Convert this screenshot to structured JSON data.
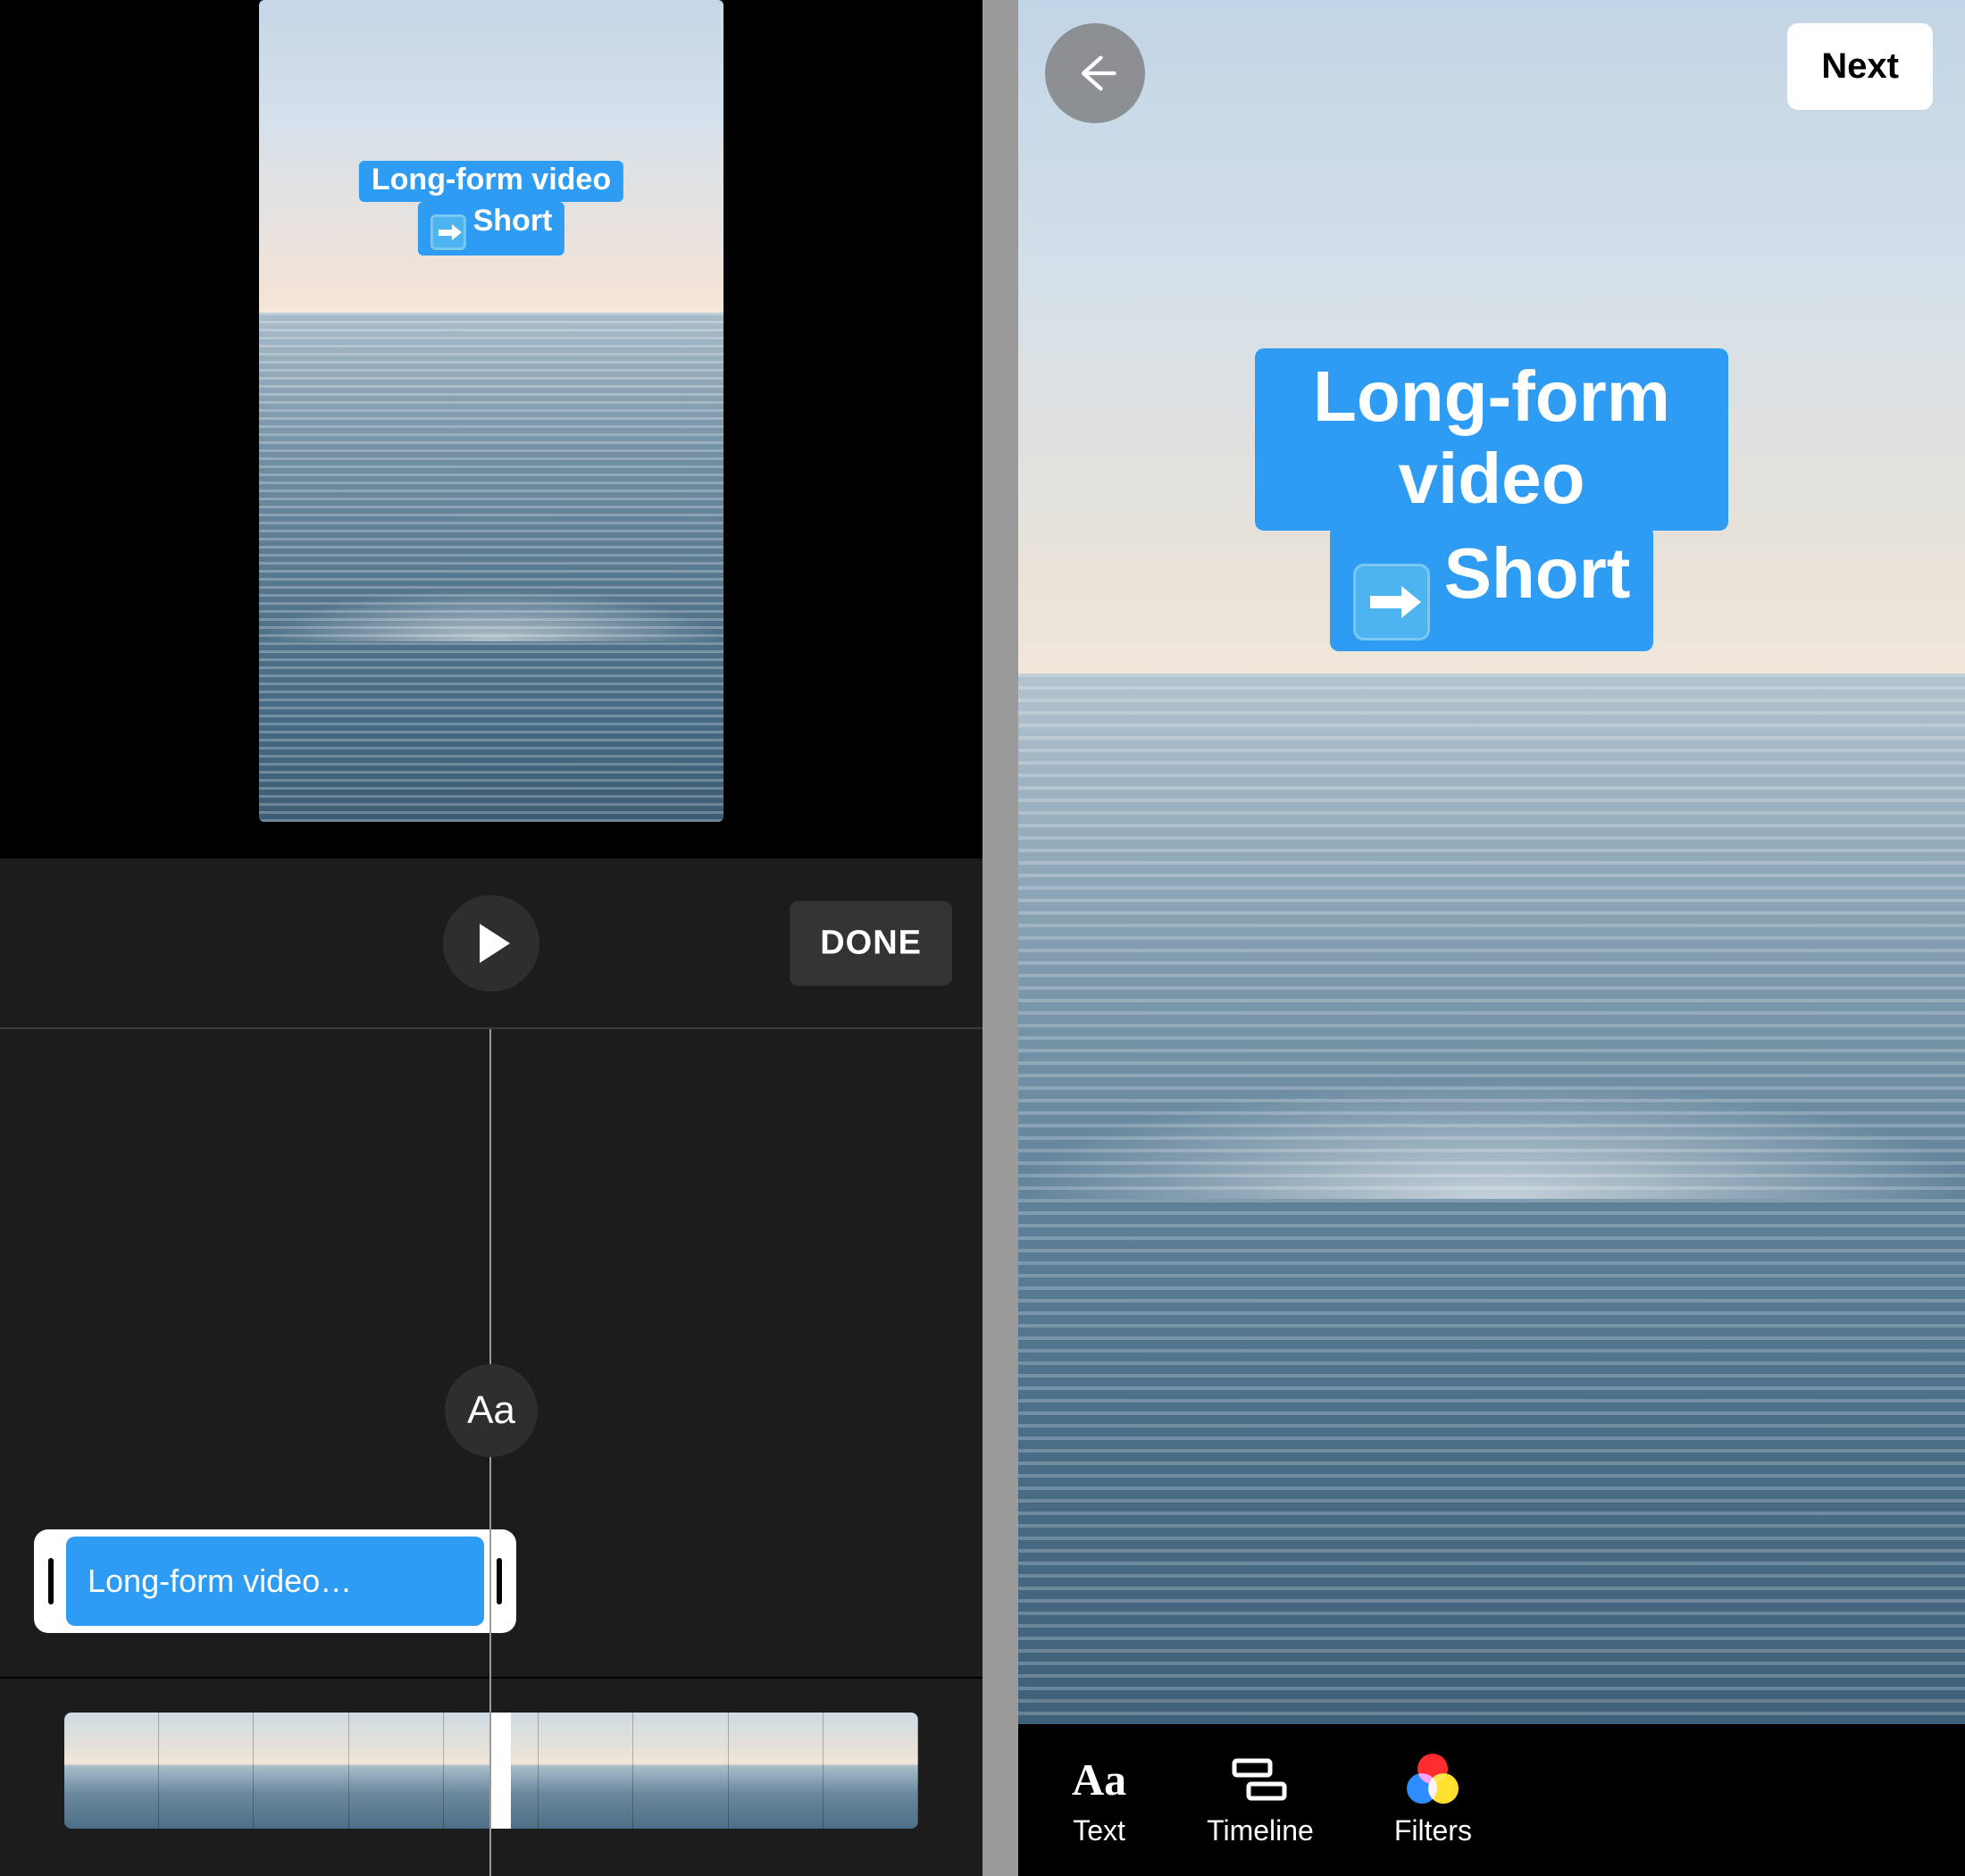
{
  "left": {
    "preview": {
      "sticker_line1": "Long-form video",
      "sticker_line2": "Short"
    },
    "controls": {
      "done_label": "DONE"
    },
    "timeline": {
      "text_marker_label": "Aa",
      "text_clip_label": "Long-form video…"
    }
  },
  "right": {
    "back_label": "Back",
    "next_label": "Next",
    "sticker_line1": "Long-form video",
    "sticker_line2": "Short",
    "tools": {
      "text": "Text",
      "timeline": "Timeline",
      "filters": "Filters"
    }
  }
}
